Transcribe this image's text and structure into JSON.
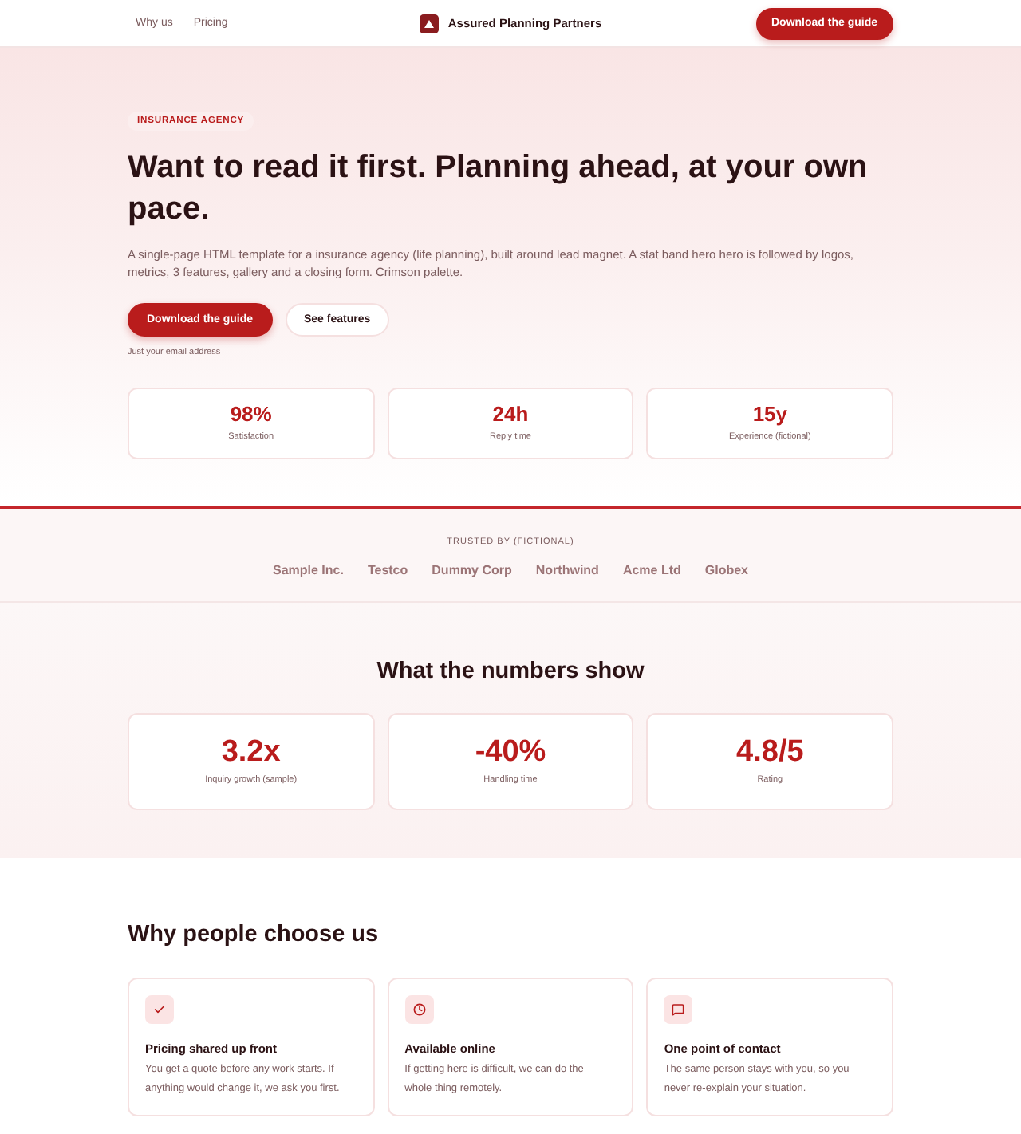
{
  "nav": {
    "links": [
      {
        "label": "Why us"
      },
      {
        "label": "Pricing"
      }
    ],
    "brand": "Assured Planning Partners",
    "cta": "Download the guide"
  },
  "hero": {
    "badge": "INSURANCE AGENCY",
    "title": "Want to read it first. Planning ahead, at your own pace.",
    "lead": "A single-page HTML template for a insurance agency (life planning), built around lead magnet. A stat band hero hero is followed by logos, metrics, 3 features, gallery and a closing form. Crimson palette.",
    "buttons": [
      {
        "label": "Download the guide",
        "kind": "primary"
      },
      {
        "label": "See features",
        "kind": "secondary"
      }
    ],
    "note": "Just your email address",
    "stats": [
      {
        "value": "98%",
        "label": "Satisfaction"
      },
      {
        "value": "24h",
        "label": "Reply time"
      },
      {
        "value": "15y",
        "label": "Experience (fictional)"
      }
    ]
  },
  "logos": {
    "heading": "TRUSTED BY (FICTIONAL)",
    "names": [
      "Sample Inc.",
      "Testco",
      "Dummy Corp",
      "Northwind",
      "Acme Ltd",
      "Globex"
    ]
  },
  "metrics": {
    "title": "What the numbers show",
    "items": [
      {
        "value": "3.2x",
        "label": "Inquiry growth (sample)"
      },
      {
        "value": "-40%",
        "label": "Handling time"
      },
      {
        "value": "4.8/5",
        "label": "Rating"
      }
    ]
  },
  "features": {
    "title": "Why people choose us",
    "items": [
      {
        "title": "Pricing shared up front",
        "text": "You get a quote before any work starts. If anything would change it, we ask you first."
      },
      {
        "title": "Available online",
        "text": "If getting here is difficult, we can do the whole thing remotely."
      },
      {
        "title": "One point of contact",
        "text": "The same person stays with you, so you never re-explain your situation."
      }
    ]
  }
}
